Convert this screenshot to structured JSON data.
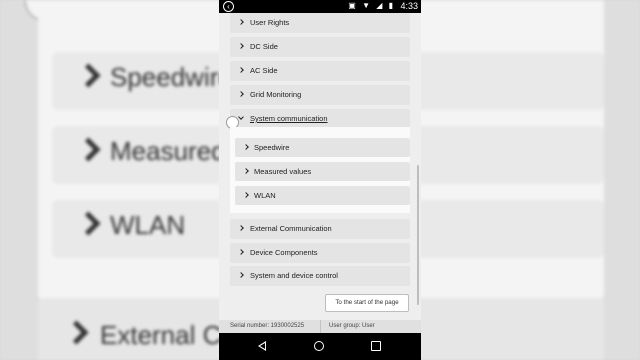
{
  "background": {
    "rows": [
      "Speedwire",
      "Measured",
      "WLAN"
    ],
    "outer_row": "External C"
  },
  "status_bar": {
    "time": "4:33"
  },
  "menu": {
    "items": [
      {
        "label": "User Rights"
      },
      {
        "label": "DC Side"
      },
      {
        "label": "AC Side"
      },
      {
        "label": "Grid Monitoring"
      },
      {
        "label": "System communication",
        "expanded": true
      },
      {
        "label": "External Communication"
      },
      {
        "label": "Device Components"
      },
      {
        "label": "System and device control"
      }
    ],
    "sub_items": [
      {
        "label": "Speedwire"
      },
      {
        "label": "Measured values"
      },
      {
        "label": "WLAN"
      }
    ]
  },
  "start_button": "To the start of the page",
  "footer": {
    "serial": "Serial number: 1930002525",
    "user_group": "User group: User"
  },
  "colors": {
    "accent": "#222222",
    "panel": "#e4e4e4"
  }
}
